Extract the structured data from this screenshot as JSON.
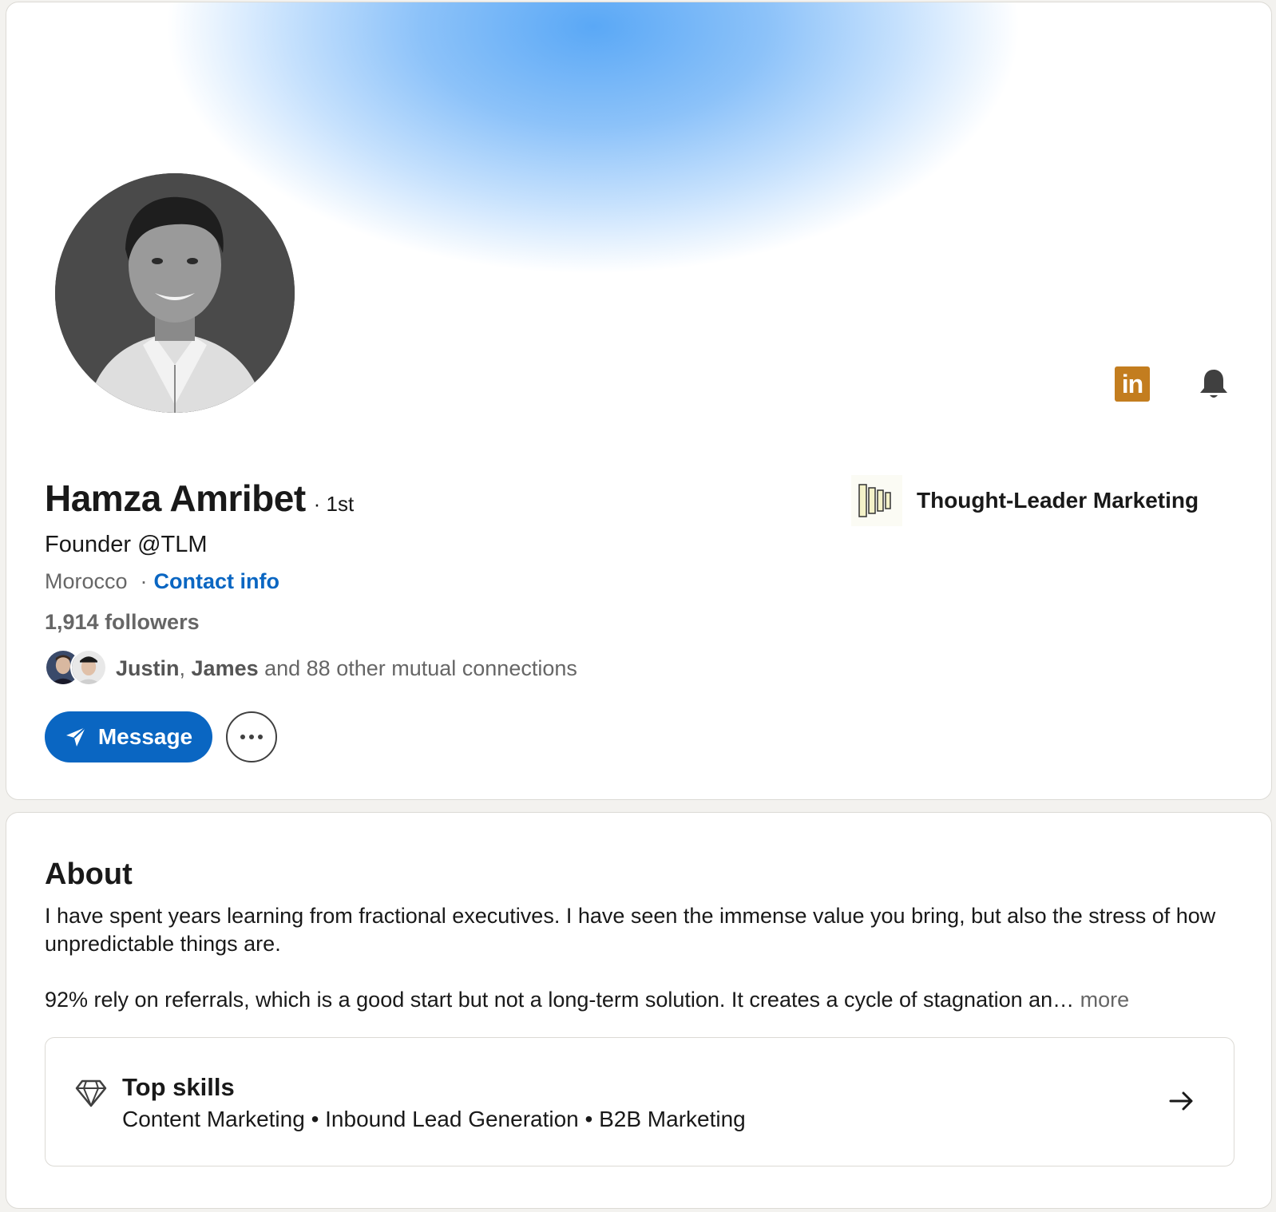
{
  "profile": {
    "name": "Hamza Amribet",
    "degree": "· 1st",
    "headline": "Founder @TLM",
    "location": "Morocco",
    "location_separator": "·",
    "contact_info_label": "Contact info",
    "followers": "1,914 followers",
    "mutual": {
      "names_1": "Justin",
      "separator": ", ",
      "names_2": "James",
      "rest": " and 88 other mutual connections"
    },
    "actions": {
      "message_label": "Message"
    },
    "company": {
      "name": "Thought-Leader Marketing"
    },
    "icons": [
      "linkedin-icon",
      "bell-icon",
      "send-icon",
      "more-icon"
    ],
    "linkedin_badge": "in"
  },
  "about": {
    "title": "About",
    "paragraph_1": "I have spent years learning from fractional executives. I have seen the immense value you bring, but also the stress of how unpredictable things are.",
    "paragraph_2": "92% rely on referrals, which is a good start but not a long-term solution. It creates a cycle of stagnation an…",
    "more_label": " more",
    "top_skills": {
      "title": "Top skills",
      "skills": "Content Marketing • Inbound Lead Generation • B2B Marketing"
    }
  },
  "colors": {
    "accent": "#0a66c2",
    "linkedin_badge": "#c37d1f",
    "banner": "#5aa8f6"
  }
}
